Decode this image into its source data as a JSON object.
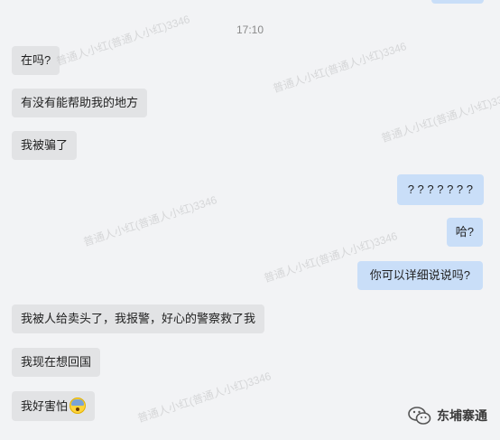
{
  "time": "17:10",
  "messages": [
    {
      "text": "在吗?",
      "side": "in"
    },
    {
      "text": "有没有能帮助我的地方",
      "side": "in"
    },
    {
      "text": "我被骗了",
      "side": "in"
    },
    {
      "text": "? ? ? ? ? ? ?",
      "side": "out"
    },
    {
      "text": "哈?",
      "side": "out"
    },
    {
      "text": "你可以详细说说吗?",
      "side": "out"
    },
    {
      "text": "我被人给卖头了，我报警，好心的警察救了我",
      "side": "in"
    },
    {
      "text": "我现在想回国",
      "side": "in"
    },
    {
      "text": "我好害怕",
      "side": "in",
      "emoji": "fearful-face"
    }
  ],
  "watermark": "普通人小红(普通人小红)3346",
  "brand": {
    "label": "东埔寨通",
    "icon": "wechat-icon"
  },
  "colors": {
    "background": "#f2f3f5",
    "incoming": "#e2e3e5",
    "outgoing": "#c9def8"
  }
}
